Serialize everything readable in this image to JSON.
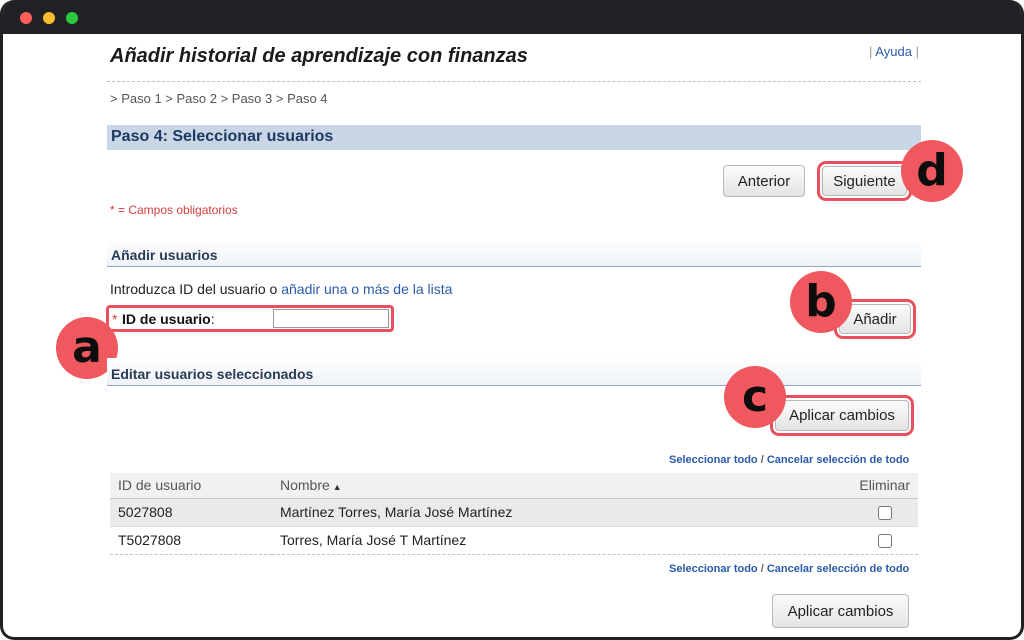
{
  "header": {
    "title": "Añadir historial de aprendizaje con finanzas",
    "help_link": "Ayuda",
    "help_sep": "|"
  },
  "breadcrumb": "> Paso 1 > Paso 2 > Paso 3 > Paso 4",
  "step": {
    "title": "Paso 4: Seleccionar usuarios",
    "back_button": "Anterior",
    "next_button": "Siguiente",
    "required_note": "* = Campos obligatorios"
  },
  "add_users": {
    "section_title": "Añadir usuarios",
    "intro_text": "Introduzca ID del usuario o",
    "intro_link": "añadir una o más de la lista",
    "field_required_mark": "*",
    "field_label": "ID de usuario",
    "field_colon": ":",
    "field_value": "",
    "add_button": "Añadir"
  },
  "edit_users": {
    "section_title": "Editar usuarios seleccionados",
    "apply_button": "Aplicar cambios",
    "select_all": "Seleccionar todo",
    "separator": "/",
    "cancel_selection": "Cancelar selección de todo",
    "table": {
      "columns": [
        "ID de usuario",
        "Nombre",
        "Eliminar"
      ],
      "sort_indicator": "▲",
      "rows": [
        {
          "id": "5027808",
          "name": "Martínez Torres, María José Martínez",
          "remove_checked": false
        },
        {
          "id": "T5027808",
          "name": "Torres, María José T Martínez",
          "remove_checked": false
        }
      ]
    }
  },
  "callouts": {
    "a": "a",
    "b": "b",
    "c": "c",
    "d": "d"
  },
  "colors": {
    "callout": "#f0585f",
    "header_band": "#c9d6e5",
    "link": "#2a5ba8",
    "required": "#d04040"
  }
}
